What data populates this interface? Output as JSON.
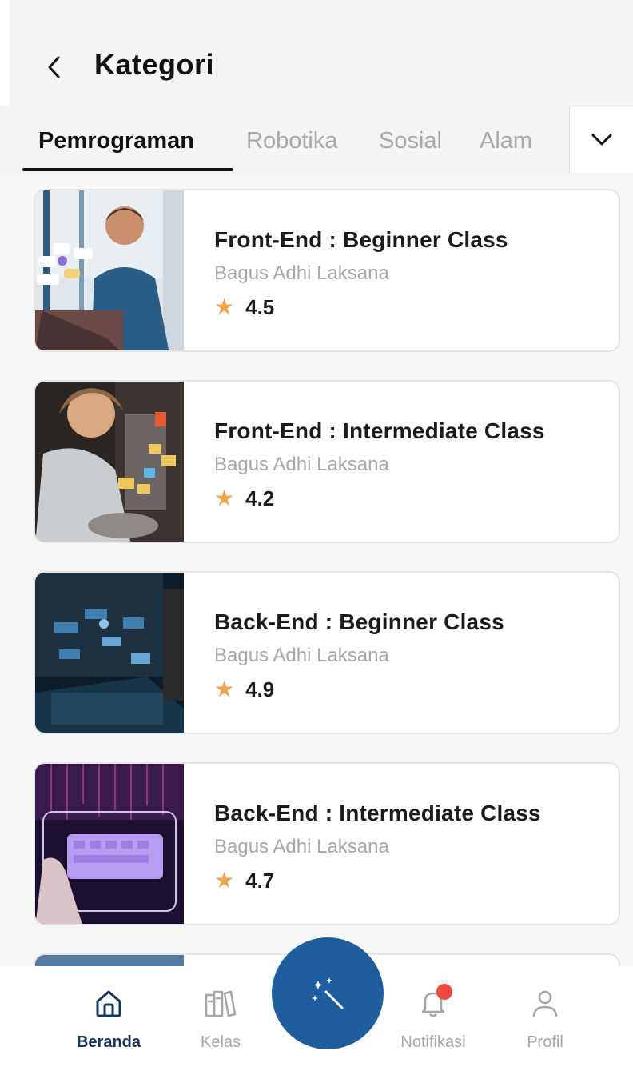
{
  "header": {
    "title": "Kategori"
  },
  "tabs": [
    {
      "label": "Pemrograman",
      "active": true
    },
    {
      "label": "Robotika",
      "active": false
    },
    {
      "label": "Sosial",
      "active": false
    },
    {
      "label": "Alam",
      "active": false
    }
  ],
  "courses": [
    {
      "title": "Front-End : Beginner Class",
      "author": "Bagus Adhi Laksana",
      "rating": "4.5"
    },
    {
      "title": "Front-End : Intermediate Class",
      "author": "Bagus Adhi Laksana",
      "rating": "4.2"
    },
    {
      "title": "Back-End : Beginner Class",
      "author": "Bagus Adhi Laksana",
      "rating": "4.9"
    },
    {
      "title": "Back-End : Intermediate Class",
      "author": "Bagus Adhi Laksana",
      "rating": "4.7"
    }
  ],
  "nav": {
    "beranda": "Beranda",
    "kelas": "Kelas",
    "notifikasi": "Notifikasi",
    "profil": "Profil"
  },
  "icons": {
    "back": "chevron-left-icon",
    "dropdown": "chevron-down-icon",
    "star": "star-icon",
    "home": "home-icon",
    "books": "books-icon",
    "magic": "magic-wand-icon",
    "bell": "bell-icon",
    "user": "user-icon"
  },
  "colors": {
    "accent": "#1e5e9e",
    "star": "#f0a54a",
    "notification": "#f0463f",
    "active_nav": "#17365f"
  }
}
